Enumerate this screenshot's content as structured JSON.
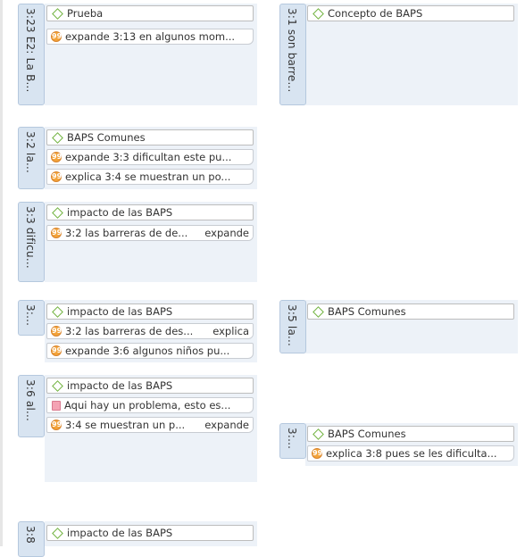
{
  "left": [
    {
      "label": "3:23 E2: La B...",
      "items": [
        {
          "type": "code",
          "text": "Prueba"
        },
        {
          "type": "quote",
          "text": "expande 3:13 en algunos mom..."
        }
      ]
    },
    {
      "label": "3:2 la...",
      "items": [
        {
          "type": "code",
          "text": "BAPS Comunes"
        },
        {
          "type": "quote",
          "text": "expande 3:3 dificultan este pu..."
        },
        {
          "type": "quote",
          "text": "explica 3:4 se muestran un po..."
        }
      ]
    },
    {
      "label": "3:3 dificu...",
      "items": [
        {
          "type": "code",
          "text": "impacto de las BAPS"
        },
        {
          "type": "quote",
          "text": "3:2 las barreras de de...",
          "relation": "expande"
        }
      ]
    },
    {
      "label": "3:...",
      "items": [
        {
          "type": "code",
          "text": "impacto de las BAPS"
        },
        {
          "type": "quote",
          "text": "3:2 las barreras de des...",
          "relation": "explica"
        },
        {
          "type": "quote",
          "text": "expande 3:6 algunos niños pu..."
        }
      ]
    },
    {
      "label": "3:6 al...",
      "items": [
        {
          "type": "code",
          "text": "impacto de las BAPS"
        },
        {
          "type": "memo",
          "text": "Aqui hay un problema, esto es..."
        },
        {
          "type": "quote",
          "text": "3:4 se muestran un p...",
          "relation": "expande"
        }
      ]
    },
    {
      "label": "3:8",
      "items": [
        {
          "type": "code",
          "text": "impacto de las BAPS"
        }
      ]
    }
  ],
  "right": [
    {
      "label": "3:1 son barre...",
      "items": [
        {
          "type": "code",
          "text": "Concepto de BAPS"
        }
      ]
    },
    {
      "label": "3:5 la...",
      "items": [
        {
          "type": "code",
          "text": "BAPS Comunes"
        }
      ]
    },
    {
      "label": "3:...",
      "items": [
        {
          "type": "code",
          "text": "BAPS Comunes"
        },
        {
          "type": "quote",
          "text": "explica 3:8 pues se les dificulta..."
        }
      ]
    }
  ]
}
